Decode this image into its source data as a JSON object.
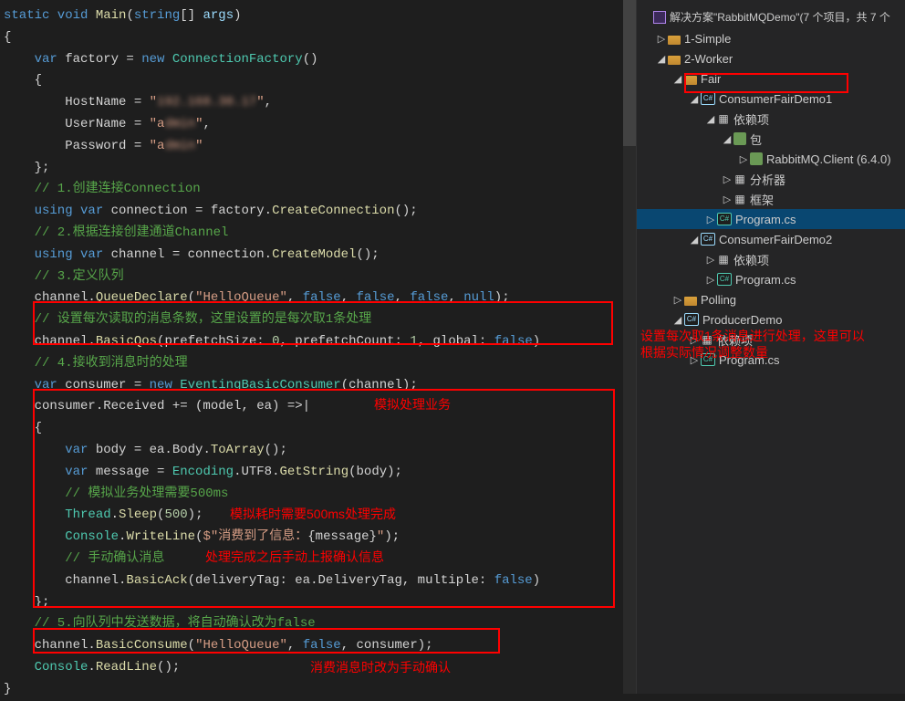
{
  "code": {
    "l1": {
      "a": "static void",
      "b": " Main",
      "c": "(",
      "d": "string",
      "e": "[] ",
      "f": "args",
      "g": ")"
    },
    "l2": "{",
    "l3": {
      "a": "    var",
      "b": " factory = ",
      "c": "new",
      "d": " ConnectionFactory",
      "e": "()"
    },
    "l4": "    {",
    "l5": {
      "a": "        HostName = ",
      "b": "\"",
      "c": "192.168.30.17",
      "d": "\"",
      "e": ","
    },
    "l6": {
      "a": "        UserName = ",
      "b": "\"a",
      "c": "dmin",
      "d": "\"",
      "e": ","
    },
    "l7": {
      "a": "        Password = ",
      "b": "\"a",
      "c": "dmin",
      "d": "\""
    },
    "l8": "    };",
    "l9": "    // 1.创建连接Connection",
    "l10": {
      "a": "    using var",
      "b": " connection = factory.",
      "c": "CreateConnection",
      "d": "();"
    },
    "l11": "    // 2.根据连接创建通道Channel",
    "l12": {
      "a": "    using var",
      "b": " channel = connection.",
      "c": "CreateModel",
      "d": "();"
    },
    "l13": "    // 3.定义队列",
    "l14": {
      "a": "    channel.",
      "b": "QueueDeclare",
      "c": "(",
      "d": "\"HelloQueue\"",
      "e": ", ",
      "f": "false",
      "g": ", ",
      "h": "false",
      "i": ", ",
      "j": "false",
      "k": ", ",
      "l": "null",
      "m": ");"
    },
    "l15": "    // 设置每次读取的消息条数，这里设置的是每次取1条处理",
    "l16": {
      "a": "    channel.",
      "b": "BasicQos",
      "c": "(prefetchSize: ",
      "d": "0",
      "e": ", prefetchCount: ",
      "f": "1",
      "g": ", global: ",
      "h": "false",
      "i": ")"
    },
    "l17": "    // 4.接收到消息时的处理",
    "l18": {
      "a": "    var",
      "b": " consumer = ",
      "c": "new",
      "d": " EventingBasicConsumer",
      "e": "(channel);"
    },
    "l19": {
      "a": "    consumer.Received += (model, ea) =>|"
    },
    "l19r": "模拟处理业务",
    "l20": "    {",
    "l21": {
      "a": "        var",
      "b": " body = ea.Body.",
      "c": "ToArray",
      "d": "();"
    },
    "l22": {
      "a": "        var",
      "b": " message = ",
      "c": "Encoding",
      "d": ".UTF8.",
      "e": "GetString",
      "f": "(body);"
    },
    "l23": "        // 模拟业务处理需要500ms",
    "l24": {
      "a": "        Thread",
      "b": ".",
      "c": "Sleep",
      "d": "(",
      "e": "500",
      "f": ");"
    },
    "l24r": "模拟耗时需要500ms处理完成",
    "l25": {
      "a": "        Console",
      "b": ".",
      "c": "WriteLine",
      "d": "(",
      "e": "$\"消费到了信息：",
      "f": "{message}",
      "g": "\"",
      "h": ");"
    },
    "l26": "        // 手动确认消息",
    "l26r": "处理完成之后手动上报确认信息",
    "l27": {
      "a": "        channel.",
      "b": "BasicAck",
      "c": "(deliveryTag: ea.DeliveryTag, multiple: ",
      "d": "false",
      "e": ")"
    },
    "l28": "    };",
    "l29": "    // 5.向队列中发送数据，将自动确认改为false",
    "l30": {
      "a": "    channel.",
      "b": "BasicConsume",
      "c": "(",
      "d": "\"HelloQueue\"",
      "e": ", ",
      "f": "false",
      "g": ", consumer);"
    },
    "l31": {
      "a": "    Console",
      "b": ".",
      "c": "ReadLine",
      "d": "();"
    },
    "l31r": "消费消息时改为手动确认",
    "l32": "}"
  },
  "annot": {
    "side1": "设置每次取1条消息进行处理，这里可以",
    "side2": "根据实际情况调整数量"
  },
  "tree": {
    "header": "解决方案\"RabbitMQDemo\"(7 个项目，共 7 个",
    "n1": "1-Simple",
    "n2": "2-Worker",
    "n3": "Fair",
    "n4": "ConsumerFairDemo1",
    "n5": "依赖项",
    "n6": "包",
    "n7": "RabbitMQ.Client (6.4.0)",
    "n8": "分析器",
    "n9": "框架",
    "n10": "Program.cs",
    "n11": "ConsumerFairDemo2",
    "n12": "依赖项",
    "n13": "Program.cs",
    "n14": "Polling",
    "n15": "ProducerDemo",
    "n16": "依赖项",
    "n17": "Program.cs"
  }
}
